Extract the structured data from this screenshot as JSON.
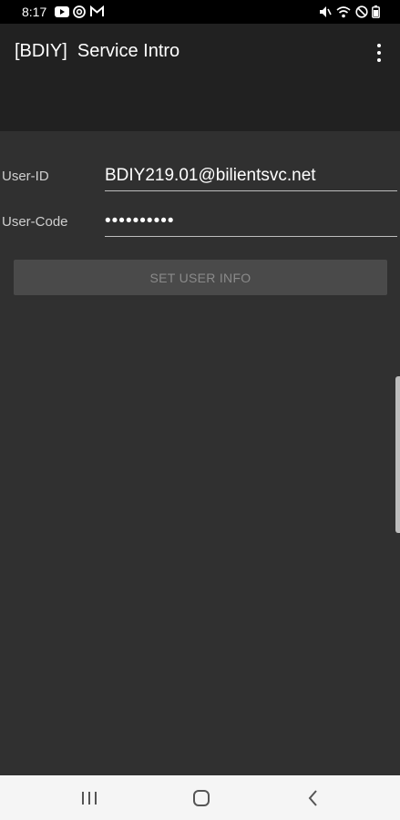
{
  "status_bar": {
    "time": "8:17",
    "left_icons": [
      "youtube-icon",
      "at-sign-icon",
      "gmail-icon"
    ],
    "right_icons": [
      "mute-icon",
      "wifi-icon",
      "dnd-icon",
      "battery-icon"
    ]
  },
  "app_bar": {
    "title": "[BDIY]  Service Intro",
    "overflow_icon": "more-vert-icon"
  },
  "form": {
    "user_id_label": "User-ID",
    "user_id_value": "BDIY219.01@bilientsvc.net",
    "user_code_label": "User-Code",
    "user_code_value": "••••••••••",
    "submit_label": "SET USER INFO"
  },
  "nav_bar": {
    "recents_icon": "recents-icon",
    "home_icon": "home-icon",
    "back_icon": "back-icon"
  },
  "colors": {
    "status_bar": "#000000",
    "app_bar": "#212121",
    "background": "#303030",
    "button": "#4a4a4a",
    "button_text": "#8a8a8a",
    "nav_bar": "#f5f5f5"
  }
}
